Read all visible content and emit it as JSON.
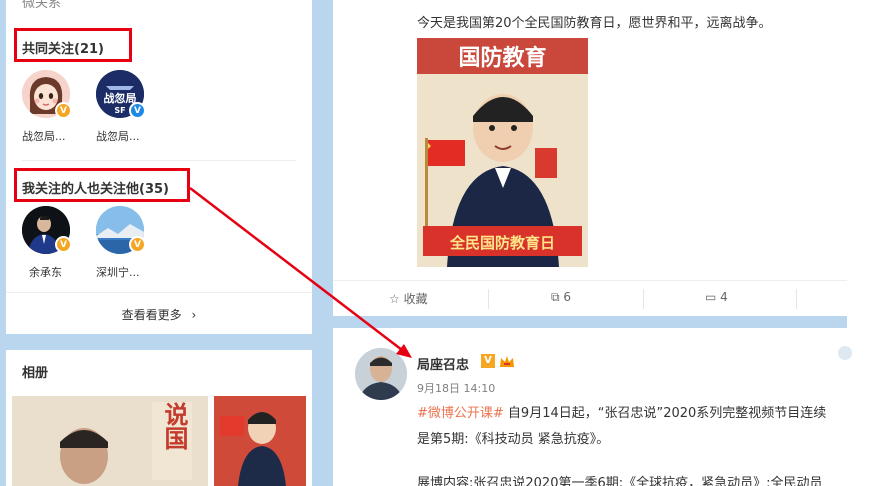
{
  "sidebar": {
    "faded_title": "微关系",
    "mutual_follow": {
      "title": "共同关注(21)",
      "users": [
        {
          "name": "战忽局...",
          "badge": "gold",
          "avatar_text": ""
        },
        {
          "name": "战忽局...",
          "badge": "blue",
          "avatar_text": "战忽局"
        }
      ]
    },
    "followed_by_follows": {
      "title": "我关注的人也关注他(35)",
      "users": [
        {
          "name": "余承东",
          "badge": "gold"
        },
        {
          "name": "深圳宁...",
          "badge": "gold"
        }
      ]
    },
    "view_more": "查看看更多",
    "view_more_icon": "chevron-right-icon"
  },
  "album": {
    "title": "相册",
    "thumb_text": "说国"
  },
  "feed": {
    "post1": {
      "text": "今天是我国第20个全民国防教育日，愿世界和平，远离战争。",
      "poster_title": "国防教育",
      "poster_banner": "全民国防教育日",
      "actions": {
        "favorite_label": "收藏",
        "repost_count": "6",
        "comment_count": "4"
      }
    },
    "post2": {
      "author": "局座召忠",
      "badge_v": "V",
      "time": "9月18日 14:10",
      "topic": "#微博公开课#",
      "line1_rest": " 自9月14日起，“张召忠说”2020系列完整视频节目连续",
      "line2": "是第5期:《科技动员 紧急抗疫》。",
      "line3": "展博内容:张召忠说2020第一季6期:《全球抗疫，紧急动员》:全民动员"
    }
  },
  "colors": {
    "highlight_red": "#e60012",
    "page_bg": "#b9d6ee",
    "topic_orange": "#eb7350",
    "gold_badge": "#f5a623",
    "blue_badge": "#1e88e5"
  }
}
